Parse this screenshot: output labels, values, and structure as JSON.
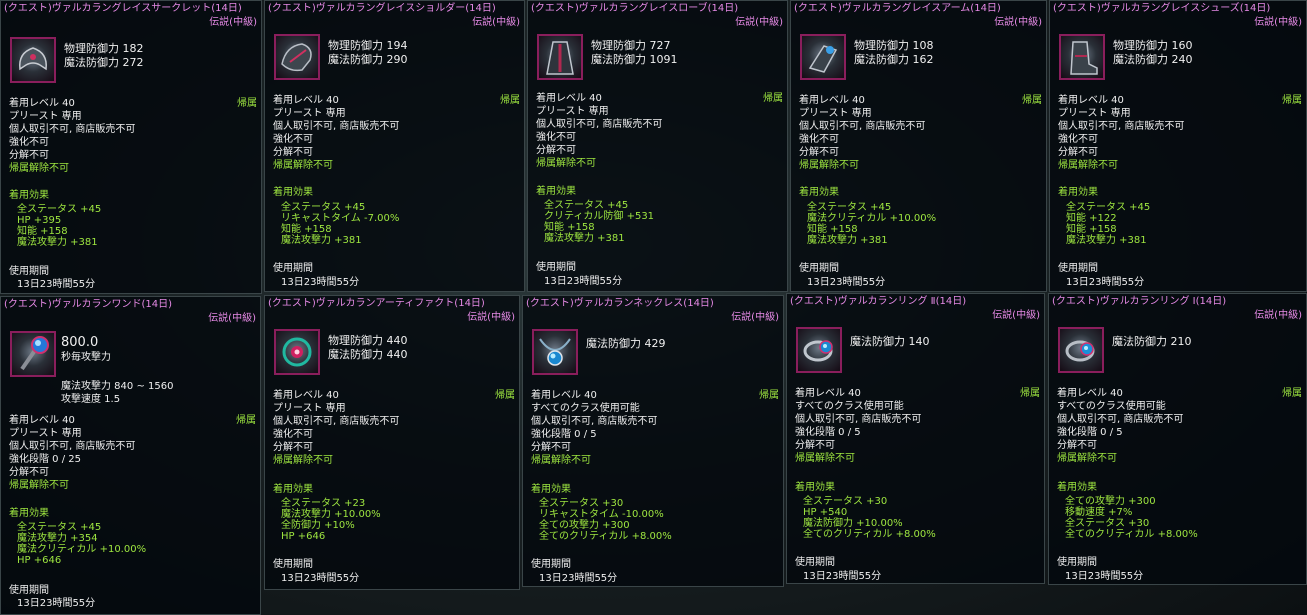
{
  "items": [
    {
      "title": "(クエスト)ヴァルカラングレイスサークレット(14日)",
      "grade": "伝説(中級)",
      "stats": [
        "物理防御力 182",
        "魔法防御力 272"
      ],
      "bind": "帰属",
      "info": [
        "着用レベル 40",
        "プリースト 専用",
        "個人取引不可, 商店販売不可",
        "強化不可",
        "分解不可"
      ],
      "unbind": "帰属解除不可",
      "effects_label": "着用効果",
      "effects": [
        "全ステータス +45",
        "HP +395",
        "知能 +158",
        "魔法攻撃力 +381"
      ],
      "period_label": "使用期間",
      "period": "13日23時間55分"
    },
    {
      "title": "(クエスト)ヴァルカラングレイスショルダー(14日)",
      "grade": "伝説(中級)",
      "stats": [
        "物理防御力 194",
        "魔法防御力 290"
      ],
      "bind": "帰属",
      "info": [
        "着用レベル 40",
        "プリースト 専用",
        "個人取引不可, 商店販売不可",
        "強化不可",
        "分解不可"
      ],
      "unbind": "帰属解除不可",
      "effects_label": "着用効果",
      "effects": [
        "全ステータス +45",
        "リキャストタイム -7.00%",
        "知能 +158",
        "魔法攻撃力 +381"
      ],
      "period_label": "使用期間",
      "period": "13日23時間55分"
    },
    {
      "title": "(クエスト)ヴァルカラングレイスローブ(14日)",
      "grade": "伝説(中級)",
      "stats": [
        "物理防御力 727",
        "魔法防御力 1091"
      ],
      "bind": "帰属",
      "info": [
        "着用レベル 40",
        "プリースト 専用",
        "個人取引不可, 商店販売不可",
        "強化不可",
        "分解不可"
      ],
      "unbind": "帰属解除不可",
      "effects_label": "着用効果",
      "effects": [
        "全ステータス +45",
        "クリティカル防御 +531",
        "知能 +158",
        "魔法攻撃力 +381"
      ],
      "period_label": "使用期間",
      "period": "13日23時間55分"
    },
    {
      "title": "(クエスト)ヴァルカラングレイスアーム(14日)",
      "grade": "伝説(中級)",
      "stats": [
        "物理防御力 108",
        "魔法防御力 162"
      ],
      "bind": "帰属",
      "info": [
        "着用レベル 40",
        "プリースト 専用",
        "個人取引不可, 商店販売不可",
        "強化不可",
        "分解不可"
      ],
      "unbind": "帰属解除不可",
      "effects_label": "着用効果",
      "effects": [
        "全ステータス +45",
        "魔法クリティカル +10.00%",
        "知能 +158",
        "魔法攻撃力 +381"
      ],
      "period_label": "使用期間",
      "period": "13日23時間55分"
    },
    {
      "title": "(クエスト)ヴァルカラングレイスシューズ(14日)",
      "grade": "伝説(中級)",
      "stats": [
        "物理防御力 160",
        "魔法防御力 240"
      ],
      "bind": "帰属",
      "info": [
        "着用レベル 40",
        "プリースト 専用",
        "個人取引不可, 商店販売不可",
        "強化不可",
        "分解不可"
      ],
      "unbind": "帰属解除不可",
      "effects_label": "着用効果",
      "effects": [
        "全ステータス +45",
        "知能 +122",
        "知能 +158",
        "魔法攻撃力 +381"
      ],
      "period_label": "使用期間",
      "period": "13日23時間55分"
    },
    {
      "title": "(クエスト)ヴァルカランワンド(14日)",
      "grade": "伝説(中級)",
      "stats": [
        "800.0",
        "秒毎攻撃力"
      ],
      "extra": [
        "魔法攻撃力 840 ~ 1560",
        "攻撃速度 1.5"
      ],
      "bind": "帰属",
      "info": [
        "着用レベル 40",
        "プリースト 専用",
        "個人取引不可, 商店販売不可",
        "強化段階 0 / 25",
        "分解不可"
      ],
      "unbind": "帰属解除不可",
      "effects_label": "着用効果",
      "effects": [
        "全ステータス +45",
        "魔法攻撃力 +354",
        "魔法クリティカル +10.00%",
        "HP +646"
      ],
      "period_label": "使用期間",
      "period": "13日23時間55分"
    },
    {
      "title": "(クエスト)ヴァルカランアーティファクト(14日)",
      "grade": "伝説(中級)",
      "stats": [
        "物理防御力 440",
        "魔法防御力 440"
      ],
      "bind": "帰属",
      "info": [
        "着用レベル 40",
        "プリースト 専用",
        "個人取引不可, 商店販売不可",
        "強化不可",
        "分解不可"
      ],
      "unbind": "帰属解除不可",
      "effects_label": "着用効果",
      "effects": [
        "全ステータス +23",
        "魔法攻撃力 +10.00%",
        "全防御力 +10%",
        "HP +646"
      ],
      "period_label": "使用期間",
      "period": "13日23時間55分"
    },
    {
      "title": "(クエスト)ヴァルカランネックレス(14日)",
      "grade": "伝説(中級)",
      "stats": [
        "魔法防御力 429"
      ],
      "bind": "帰属",
      "info": [
        "着用レベル 40",
        "すべてのクラス使用可能",
        "個人取引不可, 商店販売不可",
        "強化段階 0 / 5",
        "分解不可"
      ],
      "unbind": "帰属解除不可",
      "effects_label": "着用効果",
      "effects": [
        "全ステータス +30",
        "リキャストタイム -10.00%",
        "全ての攻撃力 +300",
        "全てのクリティカル +8.00%"
      ],
      "period_label": "使用期間",
      "period": "13日23時間55分"
    },
    {
      "title": "(クエスト)ヴァルカランリング Ⅱ(14日)",
      "grade": "伝説(中級)",
      "stats": [
        "魔法防御力 140"
      ],
      "bind": "帰属",
      "info": [
        "着用レベル 40",
        "すべてのクラス使用可能",
        "個人取引不可, 商店販売不可",
        "強化段階 0 / 5",
        "分解不可"
      ],
      "unbind": "帰属解除不可",
      "effects_label": "着用効果",
      "effects": [
        "全ステータス +30",
        "HP +540",
        "魔法防御力 +10.00%",
        "全てのクリティカル +8.00%"
      ],
      "period_label": "使用期間",
      "period": "13日23時間55分"
    },
    {
      "title": "(クエスト)ヴァルカランリング Ⅰ(14日)",
      "grade": "伝説(中級)",
      "stats": [
        "魔法防御力 210"
      ],
      "bind": "帰属",
      "info": [
        "着用レベル 40",
        "すべてのクラス使用可能",
        "個人取引不可, 商店販売不可",
        "強化段階 0 / 5",
        "分解不可"
      ],
      "unbind": "帰属解除不可",
      "effects_label": "着用効果",
      "effects": [
        "全ての攻撃力 +300",
        "移動速度 +7%",
        "全ステータス +30",
        "全てのクリティカル +8.00%"
      ],
      "period_label": "使用期間",
      "period": "13日23時間55分"
    }
  ],
  "icons": [
    "circlet-icon",
    "shoulder-icon",
    "robe-icon",
    "arm-icon",
    "shoes-icon",
    "wand-icon",
    "artifact-icon",
    "necklace-icon",
    "ring-icon",
    "ring-icon"
  ],
  "colors": {
    "title": "#e68ae6",
    "effect": "#9ee640",
    "text": "#f0f0f0",
    "icon_border": "#8a1e5c"
  }
}
